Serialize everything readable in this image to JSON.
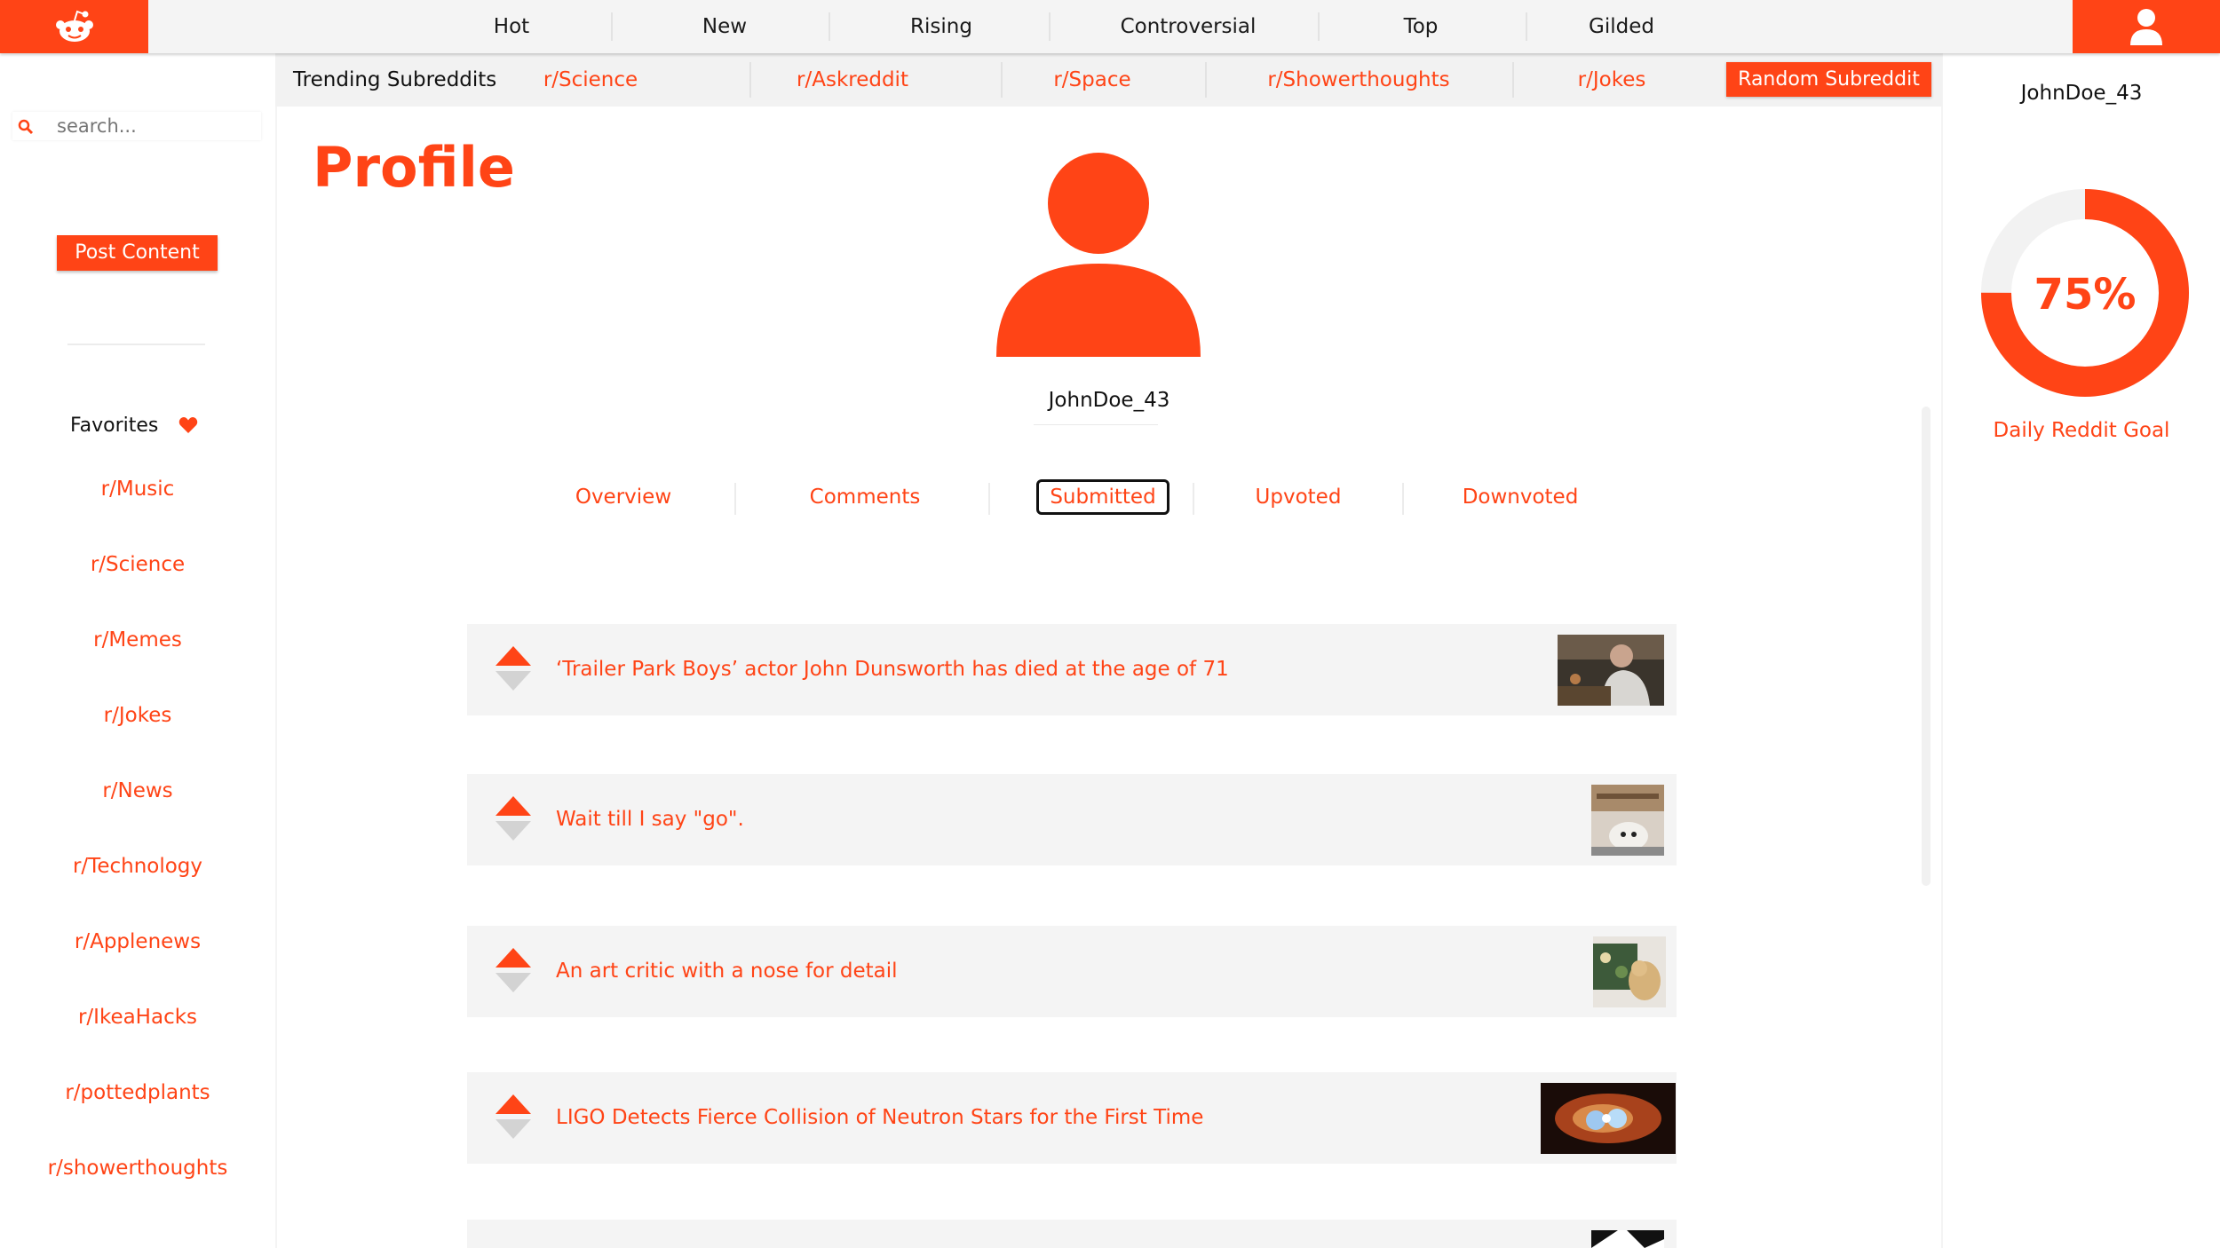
{
  "nav": {
    "tabs": [
      "Hot",
      "New",
      "Rising",
      "Controversial",
      "Top",
      "Gilded"
    ]
  },
  "search": {
    "placeholder": "search..."
  },
  "sidebar": {
    "post_button": "Post Content",
    "favorites_title": "Favorites",
    "favorites": [
      "r/Music",
      "r/Science",
      "r/Memes",
      "r/Jokes",
      "r/News",
      "r/Technology",
      "r/Applenews",
      "r/IkeaHacks",
      "r/pottedplants",
      "r/showerthoughts"
    ]
  },
  "trending": {
    "title": "Trending Subreddits",
    "items": [
      "r/Science",
      "r/Askreddit",
      "r/Space",
      "r/Showerthoughts",
      "r/Jokes"
    ],
    "random_button": "Random Subreddit"
  },
  "profile": {
    "title": "Profile",
    "username": "JohnDoe_43",
    "tabs": [
      "Overview",
      "Comments",
      "Submitted",
      "Upvoted",
      "Downvoted"
    ],
    "active_tab": "Submitted",
    "posts": [
      {
        "title": "‘Trailer Park Boys’ actor John Dunsworth has died at the age of 71",
        "thumb": "photo-man-at-table"
      },
      {
        "title": "Wait till I say \"go\".",
        "thumb": "photo-dog"
      },
      {
        "title": "An art critic with a nose for detail",
        "thumb": "photo-dog-painting"
      },
      {
        "title": "LIGO Detects Fierce Collision of Neutron Stars for the First Time",
        "thumb": "photo-neutron-stars"
      }
    ]
  },
  "right_panel": {
    "username": "JohnDoe_43",
    "goal_percent": 75,
    "goal_text": "75%",
    "goal_label": "Daily Reddit Goal"
  },
  "colors": {
    "accent": "#ff4416",
    "background": "#f4f4f4",
    "panel": "#ffffff",
    "vote_down": "#d3d3d3"
  }
}
